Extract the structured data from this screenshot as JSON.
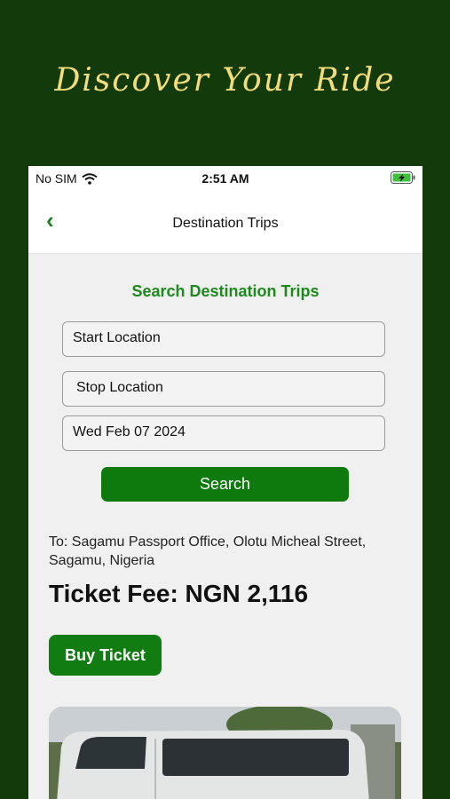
{
  "promo": {
    "headline": "Discover Your Ride"
  },
  "status_bar": {
    "carrier": "No SIM",
    "time": "2:51 AM"
  },
  "nav": {
    "title": "Destination Trips"
  },
  "search": {
    "title": "Search Destination Trips",
    "start_location": "Start Location",
    "stop_location": "Stop Location",
    "date": "Wed Feb 07 2024",
    "button_label": "Search"
  },
  "result": {
    "destination": "To: Sagamu Passport Office, Olotu Micheal Street, Sagamu, Nigeria",
    "fee": "Ticket Fee: NGN 2,116",
    "buy_label": "Buy Ticket"
  },
  "colors": {
    "background": "#133a0b",
    "accent": "#0e7a0e",
    "headline": "#f3dc7a"
  }
}
